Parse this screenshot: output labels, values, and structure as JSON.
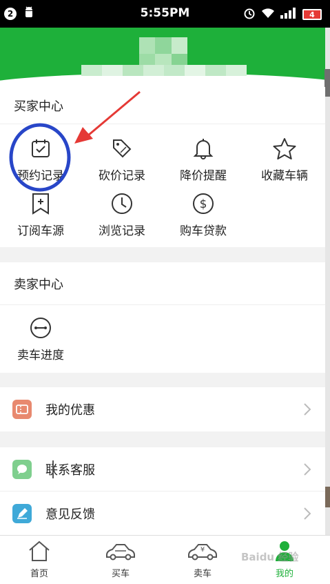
{
  "status_bar": {
    "notification_count": "2",
    "time": "5:55PM",
    "battery": "4"
  },
  "buyer_center": {
    "title": "买家中心",
    "items": [
      {
        "label": "预约记录",
        "icon": "calendar-check-icon"
      },
      {
        "label": "砍价记录",
        "icon": "price-tag-icon"
      },
      {
        "label": "降价提醒",
        "icon": "bell-icon"
      },
      {
        "label": "收藏车辆",
        "icon": "star-icon"
      },
      {
        "label": "订阅车源",
        "icon": "bookmark-plus-icon"
      },
      {
        "label": "浏览记录",
        "icon": "clock-icon"
      },
      {
        "label": "购车贷款",
        "icon": "dollar-icon"
      }
    ]
  },
  "seller_center": {
    "title": "卖家中心",
    "items": [
      {
        "label": "卖车进度",
        "icon": "progress-icon"
      }
    ]
  },
  "menu": {
    "coupons": "我的优惠",
    "support": "联系客服",
    "feedback": "意见反馈"
  },
  "tabs": [
    {
      "label": "首页",
      "icon": "home-icon"
    },
    {
      "label": "买车",
      "icon": "car-icon"
    },
    {
      "label": "卖车",
      "icon": "car-yuan-icon"
    },
    {
      "label": "我的",
      "icon": "user-icon",
      "active": true
    }
  ],
  "colors": {
    "brand_green": "#1eb03a",
    "annotation_blue": "#2846c8",
    "annotation_red": "#e53935",
    "coupon_icon": "#e8896f",
    "support_icon": "#7fcf8e",
    "feedback_icon": "#3fa9d8"
  }
}
